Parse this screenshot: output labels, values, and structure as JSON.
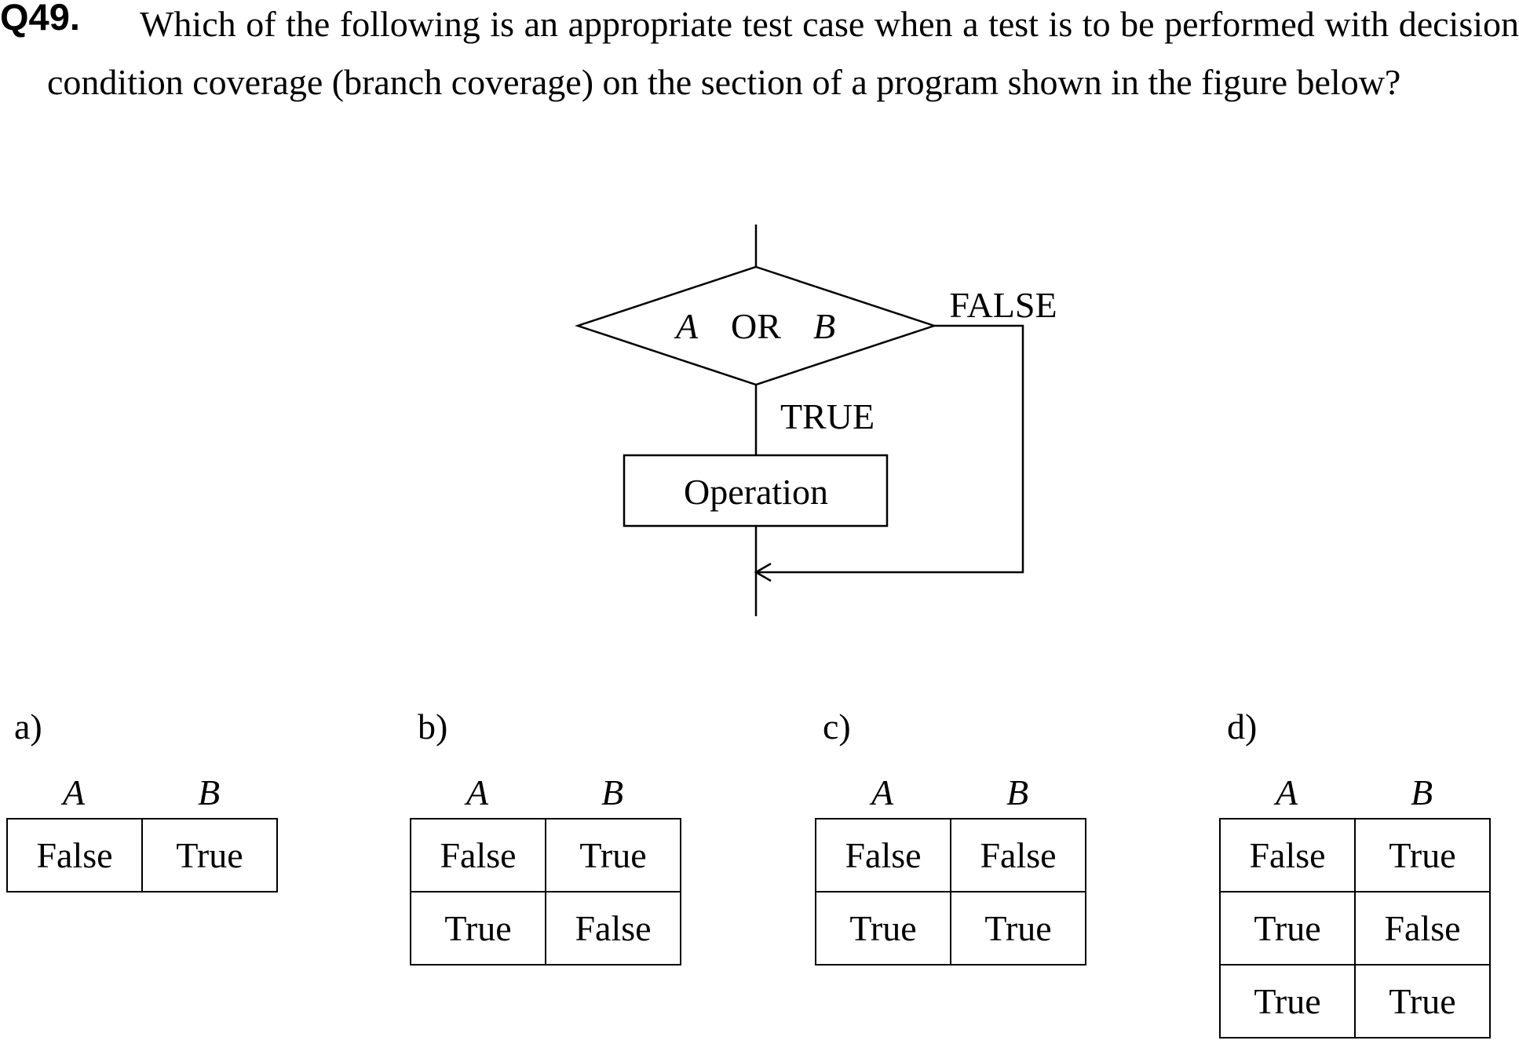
{
  "question": {
    "number": "Q49.",
    "text": "Which of the following is an appropriate test case when a test is to be performed with decision condition coverage (branch coverage) on the section of a program shown in the figure below?"
  },
  "flowchart": {
    "condition_a": "A",
    "condition_op": "OR",
    "condition_b": "B",
    "false_label": "FALSE",
    "true_label": "TRUE",
    "process_label": "Operation"
  },
  "options": [
    {
      "label": "a)",
      "col_a": "A",
      "col_b": "B",
      "rows": [
        [
          "False",
          "True"
        ]
      ]
    },
    {
      "label": "b)",
      "col_a": "A",
      "col_b": "B",
      "rows": [
        [
          "False",
          "True"
        ],
        [
          "True",
          "False"
        ]
      ]
    },
    {
      "label": "c)",
      "col_a": "A",
      "col_b": "B",
      "rows": [
        [
          "False",
          "False"
        ],
        [
          "True",
          "True"
        ]
      ]
    },
    {
      "label": "d)",
      "col_a": "A",
      "col_b": "B",
      "rows": [
        [
          "False",
          "True"
        ],
        [
          "True",
          "False"
        ],
        [
          "True",
          "True"
        ]
      ]
    }
  ]
}
